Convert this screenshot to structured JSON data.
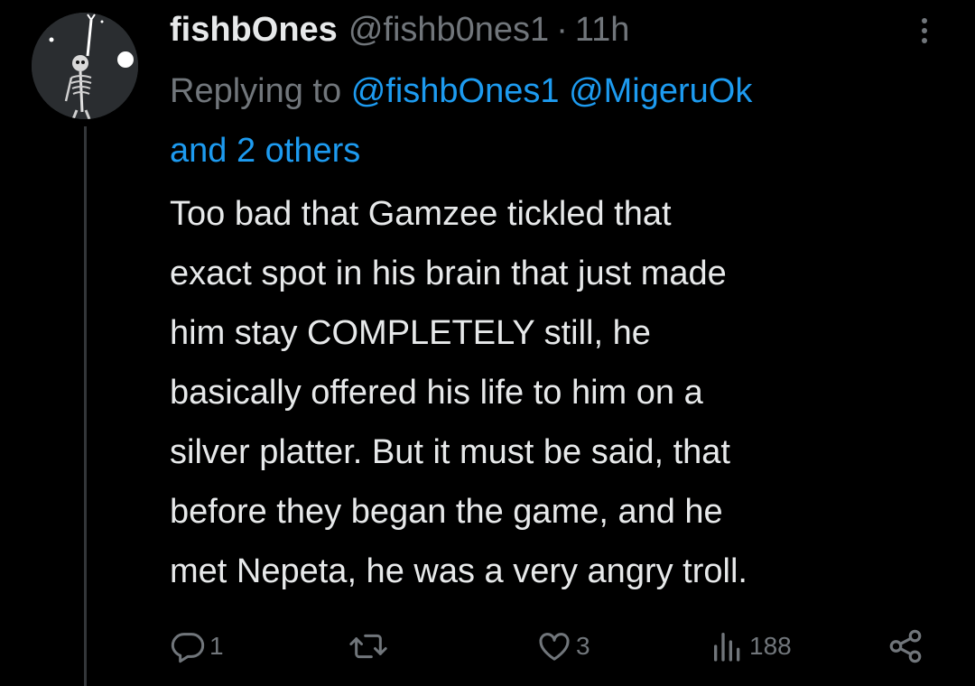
{
  "tweet": {
    "author": {
      "display_name": "fishbOnes",
      "handle": "@fishb0nes1",
      "avatar_icon": "skeleton-avatar"
    },
    "separator": "·",
    "time": "11h",
    "reply_context": {
      "prefix": "Replying to",
      "mentions": [
        "@fishbOnes1",
        "@MigeruOk"
      ],
      "others": "and 2 others"
    },
    "text_lines": [
      "Too bad that Gamzee tickled that",
      "exact spot in his brain that just made",
      "him stay COMPLETELY still, he",
      "basically offered his life to him on a",
      "silver platter. But it must be said, that",
      "before they began the game, and he",
      "met Nepeta, he was a very angry troll."
    ],
    "actions": {
      "reply": {
        "icon": "reply-icon",
        "count": "1"
      },
      "retweet": {
        "icon": "retweet-icon",
        "count": ""
      },
      "like": {
        "icon": "heart-icon",
        "count": "3"
      },
      "views": {
        "icon": "views-icon",
        "count": "188"
      },
      "share": {
        "icon": "share-icon"
      }
    },
    "more_icon": "more-icon"
  },
  "colors": {
    "background": "#000000",
    "primary_text": "#e7e9ea",
    "secondary_text": "#71767b",
    "link": "#1d9bf0"
  }
}
